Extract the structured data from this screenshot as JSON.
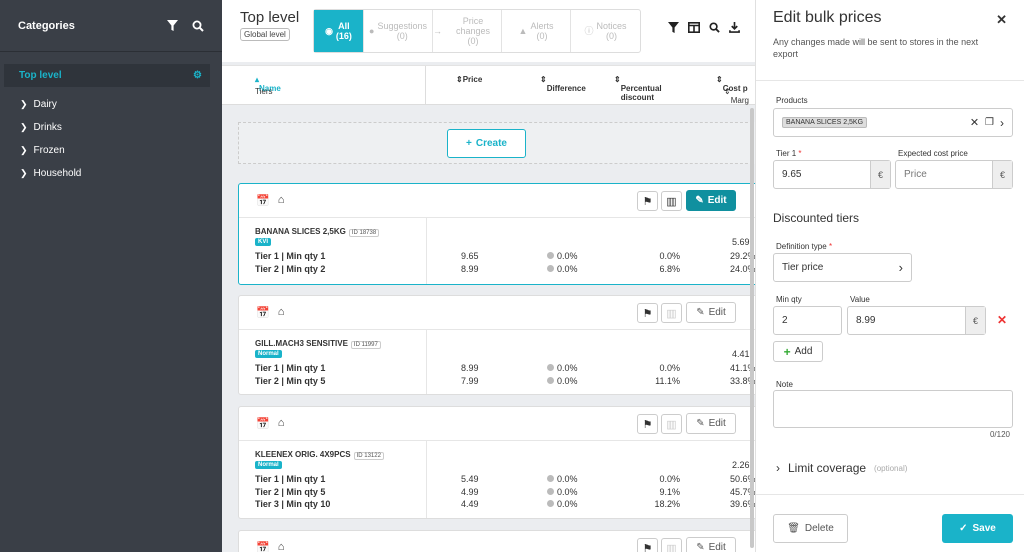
{
  "sidebar": {
    "title": "Categories",
    "items": [
      {
        "label": "Top level"
      },
      {
        "label": "Dairy"
      },
      {
        "label": "Drinks"
      },
      {
        "label": "Frozen"
      },
      {
        "label": "Household"
      }
    ]
  },
  "topbar": {
    "title": "Top level",
    "subtitle": "Global level",
    "tabs": [
      {
        "label": "All",
        "count": "(16)"
      },
      {
        "label": "Suggestions",
        "count": "(0)"
      },
      {
        "label": "Price changes",
        "count": "(0)"
      },
      {
        "label": "Alerts",
        "count": "(0)"
      },
      {
        "label": "Notices",
        "count": "(0)"
      }
    ]
  },
  "columns": {
    "name": "Name",
    "tiers": "Tiers",
    "price": "Price",
    "difference": "Difference",
    "pct_discount": "Percentual discount",
    "cost": "Cost p",
    "margin": "Marg"
  },
  "create_label": "Create",
  "edit_label": "Edit",
  "products": [
    {
      "name": "BANANA SLICES 2,5KG",
      "id": "ID 18738",
      "badge": "KVI",
      "margin_top": "5.69",
      "rows": [
        {
          "tier": "Tier 1 | Min qty 1",
          "price": "9.65",
          "diff": "0.0%",
          "pct": "0.0%",
          "margin": "29.2%"
        },
        {
          "tier": "Tier 2 | Min qty 2",
          "price": "8.99",
          "diff": "0.0%",
          "pct": "6.8%",
          "margin": "24.0%"
        }
      ]
    },
    {
      "name": "GILL.MACH3 SENSITIVE",
      "id": "ID 11997",
      "badge": "Normal",
      "margin_top": "4.41",
      "rows": [
        {
          "tier": "Tier 1 | Min qty 1",
          "price": "8.99",
          "diff": "0.0%",
          "pct": "0.0%",
          "margin": "41.1%"
        },
        {
          "tier": "Tier 2 | Min qty 5",
          "price": "7.99",
          "diff": "0.0%",
          "pct": "11.1%",
          "margin": "33.8%"
        }
      ]
    },
    {
      "name": "KLEENEX ORIG. 4X9PCS",
      "id": "ID 13122",
      "badge": "Normal",
      "margin_top": "2.26",
      "rows": [
        {
          "tier": "Tier 1 | Min qty 1",
          "price": "5.49",
          "diff": "0.0%",
          "pct": "0.0%",
          "margin": "50.6%"
        },
        {
          "tier": "Tier 2 | Min qty 5",
          "price": "4.99",
          "diff": "0.0%",
          "pct": "9.1%",
          "margin": "45.7%"
        },
        {
          "tier": "Tier 3 | Min qty 10",
          "price": "4.49",
          "diff": "0.0%",
          "pct": "18.2%",
          "margin": "39.6%"
        }
      ]
    }
  ],
  "panel": {
    "title": "Edit bulk prices",
    "description": "Any changes made will be sent to stores in the next export",
    "products_label": "Products",
    "product_chip": "BANANA SLICES 2,5KG",
    "tier1_label": "Tier 1",
    "tier1_value": "9.65",
    "expected_cost_label": "Expected cost price",
    "expected_cost_placeholder": "Price",
    "currency": "€",
    "discounted_tiers": "Discounted tiers",
    "definition_type_label": "Definition type",
    "definition_type_value": "Tier price",
    "min_qty_label": "Min qty",
    "value_label": "Value",
    "min_qty_value": "2",
    "value_value": "8.99",
    "add_label": "Add",
    "note_label": "Note",
    "note_count": "0/120",
    "limit_coverage": "Limit coverage",
    "optional": "(optional)",
    "delete_label": "Delete",
    "save_label": "Save"
  },
  "colors": {
    "accent": "#1ab3c9",
    "sidebar": "#3a3f47",
    "danger": "#e33"
  }
}
